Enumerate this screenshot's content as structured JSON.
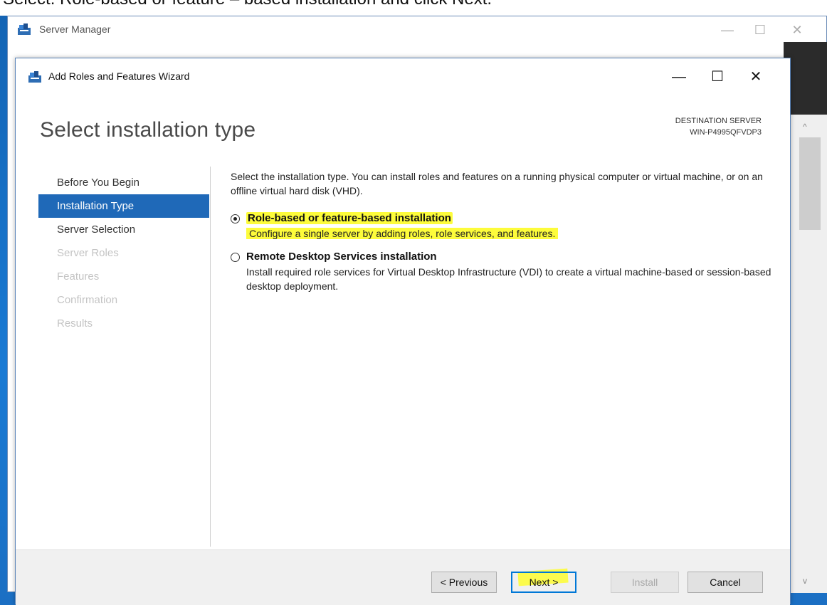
{
  "caption": "Select: Role-based or feature – based installation and click Next.",
  "server_manager": {
    "title": "Server Manager",
    "controls": {
      "minimize": "—",
      "maximize": "☐",
      "close": "✕"
    },
    "scroll_up": "^",
    "scroll_down": "v"
  },
  "wizard": {
    "title": "Add Roles and Features Wizard",
    "controls": {
      "minimize": "—",
      "maximize": "☐",
      "close": "✕"
    },
    "heading": "Select installation type",
    "destination_label": "DESTINATION SERVER",
    "destination_server": "WIN-P4995QFVDP3",
    "nav": [
      {
        "label": "Before You Begin",
        "state": "normal"
      },
      {
        "label": "Installation Type",
        "state": "active"
      },
      {
        "label": "Server Selection",
        "state": "normal"
      },
      {
        "label": "Server Roles",
        "state": "disabled"
      },
      {
        "label": "Features",
        "state": "disabled"
      },
      {
        "label": "Confirmation",
        "state": "disabled"
      },
      {
        "label": "Results",
        "state": "disabled"
      }
    ],
    "description": "Select the installation type. You can install roles and features on a running physical computer or virtual machine, or on an offline virtual hard disk (VHD).",
    "options": [
      {
        "title": "Role-based or feature-based installation",
        "desc": "Configure a single server by adding roles, role services, and features.",
        "checked": true
      },
      {
        "title": "Remote Desktop Services installation",
        "desc": "Install required role services for Virtual Desktop Infrastructure (VDI) to create a virtual machine-based or session-based desktop deployment.",
        "checked": false
      }
    ],
    "buttons": {
      "previous": "< Previous",
      "next": "Next >",
      "install": "Install",
      "cancel": "Cancel"
    }
  },
  "colors": {
    "accent": "#1f69b8",
    "highlight": "#fdfc3b",
    "desktop": "#1a73c9"
  }
}
